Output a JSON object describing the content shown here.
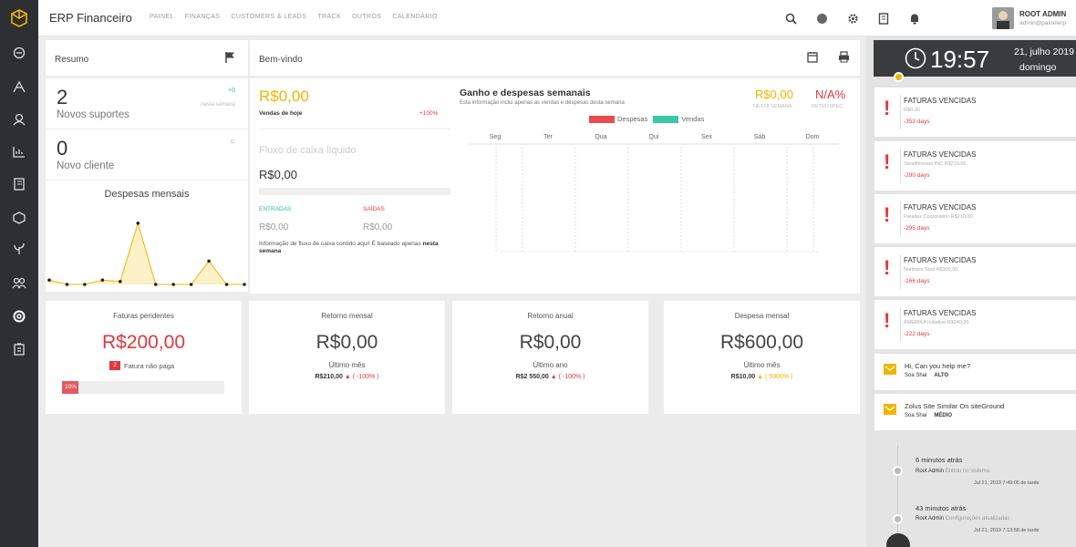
{
  "app": {
    "title": "ERP Financeiro"
  },
  "topnav": [
    "PAINEL",
    "FINANÇAS",
    "CUSTOMERS & LEADS",
    "TRACK",
    "OUTROS",
    "CALENDÁRIO"
  ],
  "user": {
    "name": "ROOT ADMIN",
    "email": "admin@painelerp"
  },
  "icons": {
    "sidebar": [
      "dashboard-icon",
      "network-icon",
      "contacts-icon",
      "chart-icon",
      "notebook-icon",
      "box-icon",
      "plant-icon",
      "users-icon",
      "support-icon",
      "clipboard-icon"
    ],
    "top": [
      "search-icon",
      "globe-icon",
      "gear-icon",
      "document-icon",
      "bell-icon"
    ]
  },
  "resumo": {
    "title": "Resumo",
    "stat1": {
      "value": "2",
      "label": "Novos suportes",
      "badge": "+0",
      "sub": "nesta semana"
    },
    "stat2": {
      "value": "0",
      "label": "Novo cliente"
    },
    "despesas_title": "Despesas mensais"
  },
  "bemvindo": {
    "title": "Bem-vindo",
    "sales_value": "R$0,00",
    "sales_label": "Vendas de hoje",
    "sales_pct": "+100%",
    "fluxo_label": "Fluxo de caixa líquido",
    "fluxo_value": "R$0,00",
    "entradas_label": "ENTRADAS",
    "saidas_label": "SAÍDAS",
    "entradas_value": "R$0,00",
    "saidas_value": "R$0,00",
    "note": "Informação de fluxo de caixa contido aqui! É baseado apenas",
    "note_bold": "nesta semana"
  },
  "weekly": {
    "title": "Ganho e despesas semanais",
    "subtitle": "Esta informação inclui apenas as vendas e despesas desta semana",
    "value1": "R$0,00",
    "value1_label": "NESTA SEMANA",
    "value2": "N/A%",
    "value2_label": "RETROSPEC",
    "legend": [
      {
        "name": "Despesas",
        "color": "#e84c4f"
      },
      {
        "name": "Vendas",
        "color": "#3cc7a6"
      }
    ],
    "days": [
      "Seg",
      "Ter",
      "Qua",
      "Qui",
      "Sex",
      "Sáb",
      "Dom"
    ]
  },
  "chart_data": {
    "type": "area",
    "title": "Despesas mensais",
    "x": [
      1,
      2,
      3,
      4,
      5,
      6,
      7,
      8,
      9,
      10,
      11,
      12
    ],
    "values": [
      0.3,
      0,
      0,
      0.3,
      0.2,
      4.2,
      0,
      0,
      0,
      1.6,
      0,
      0
    ],
    "ylim": [
      0,
      5
    ],
    "grid": false,
    "color": "#f0b400"
  },
  "kpis": [
    {
      "title": "Faturas pendentes",
      "value": "R$200,00",
      "badge_count": "2",
      "badge_text": "Fatura não paga",
      "progress_label": "10%",
      "progress": 0.1
    },
    {
      "title": "Retorno mensal",
      "value": "R$0,00",
      "sub": "Último mês",
      "detail_value": "R$210,00",
      "detail_arrow": "▲",
      "detail_pct": "( -100% )"
    },
    {
      "title": "Retorno anual",
      "value": "R$0,00",
      "sub": "Último ano",
      "detail_value": "R$2 550,00",
      "detail_arrow": "▲",
      "detail_pct": "( -100% )"
    },
    {
      "title": "Despesa mensal",
      "value": "R$600,00",
      "sub": "Último mês",
      "detail_value": "R$10,00",
      "detail_arrow": "▲",
      "detail_pct": "( 5900% )"
    }
  ],
  "clock": {
    "time": "19:57",
    "date": "21, julho 2019",
    "day": "domingo"
  },
  "alerts": [
    {
      "title": "FATURAS VENCIDAS",
      "meta": "R$0,00",
      "days": "-353 days"
    },
    {
      "title": "FATURAS VENCIDAS",
      "meta": "Stealthinners INC    R$210,00",
      "days": "-290 days"
    },
    {
      "title": "FATURAS VENCIDAS",
      "meta": "Parallax Corporation    R$210,00",
      "days": "-295 days"
    },
    {
      "title": "FATURAS VENCIDAS",
      "meta": "Northern Soul    R$300,00",
      "days": "-166 days"
    },
    {
      "title": "FATURAS VENCIDAS",
      "meta": "AMERIKA Initiative    R$240,00",
      "days": "-222 days"
    }
  ],
  "chats": [
    {
      "message": "Hi, Can you help me?",
      "who": "Soa Shai",
      "priority": "ALTO"
    },
    {
      "message": "Zolus Site Similar On siteGround",
      "who": "Soa Shai",
      "priority": "MÉDIO"
    }
  ],
  "activity": [
    {
      "time": "6 minutos atrás",
      "user": "Root Admin",
      "action": "Entrou no sistema",
      "date": "Jul 21, 2019 7:49:05 de tarde"
    },
    {
      "time": "43 minutos atrás",
      "user": "Root Admin",
      "action": "Configurações atualizadas",
      "date": "Jul 21, 2019 7:13:58 de tarde"
    }
  ]
}
